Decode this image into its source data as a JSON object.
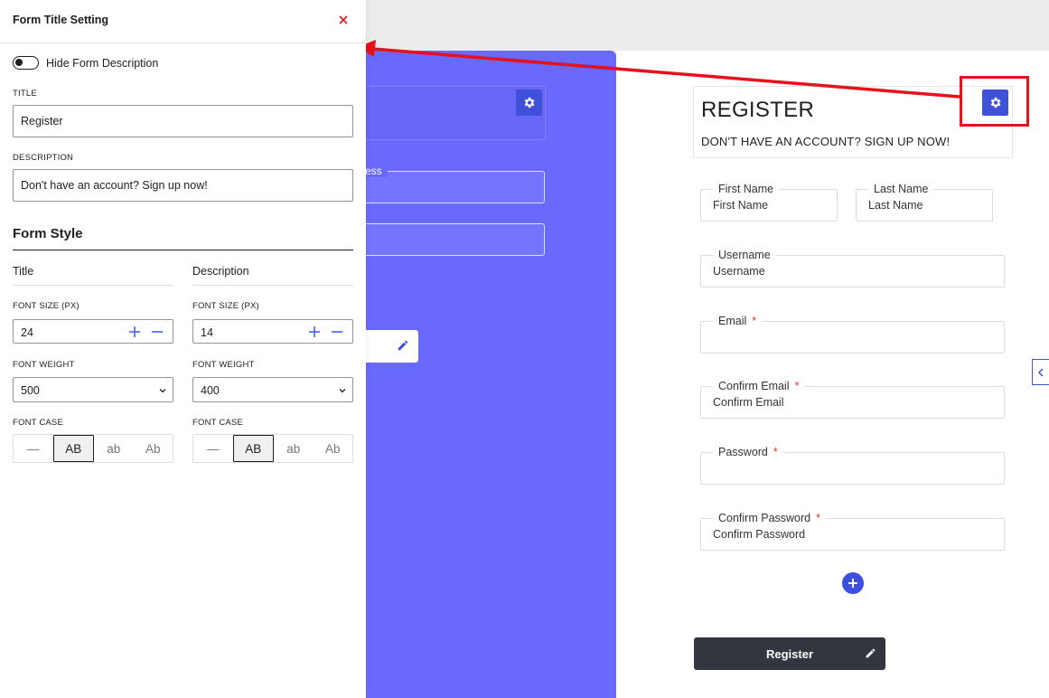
{
  "panel": {
    "title": "Form Title Setting",
    "toggle_label": "Hide Form Description",
    "title_caption": "TITLE",
    "title_value": "Register",
    "description_caption": "DESCRIPTION",
    "description_value": "Don't have an account? Sign up now!",
    "form_style_heading": "Form Style",
    "columns": {
      "title": {
        "heading": "Title",
        "font_size_caption": "FONT SIZE (PX)",
        "font_size": "24",
        "font_weight_caption": "FONT WEIGHT",
        "font_weight": "500",
        "font_case_caption": "FONT CASE"
      },
      "description": {
        "heading": "Description",
        "font_size_caption": "FONT SIZE (PX)",
        "font_size": "14",
        "font_weight_caption": "FONT WEIGHT",
        "font_weight": "400",
        "font_case_caption": "FONT CASE"
      }
    },
    "case_options": [
      "—",
      "AB",
      "ab",
      "Ab"
    ]
  },
  "canvas": {
    "purple_label": "ess"
  },
  "preview": {
    "title": "REGISTER",
    "description": "DON'T HAVE AN ACCOUNT? SIGN UP NOW!",
    "fields": [
      {
        "label": "First Name",
        "value": "First Name",
        "required": false
      },
      {
        "label": "Last Name",
        "value": "Last Name",
        "required": false
      },
      {
        "label": "Username",
        "value": "Username",
        "required": false
      },
      {
        "label": "Email",
        "value": "",
        "required": true
      },
      {
        "label": "Confirm Email",
        "value": "Confirm Email",
        "required": true
      },
      {
        "label": "Password",
        "value": "",
        "required": true
      },
      {
        "label": "Confirm Password",
        "value": "Confirm Password",
        "required": true
      }
    ],
    "required_mark": "*",
    "submit_label": "Register"
  },
  "colors": {
    "accent": "#3f51d8",
    "canvas_purple": "#6a69fe",
    "highlight_red": "#e8101a",
    "button_dark": "#33363e",
    "required_red": "#e3342f"
  }
}
